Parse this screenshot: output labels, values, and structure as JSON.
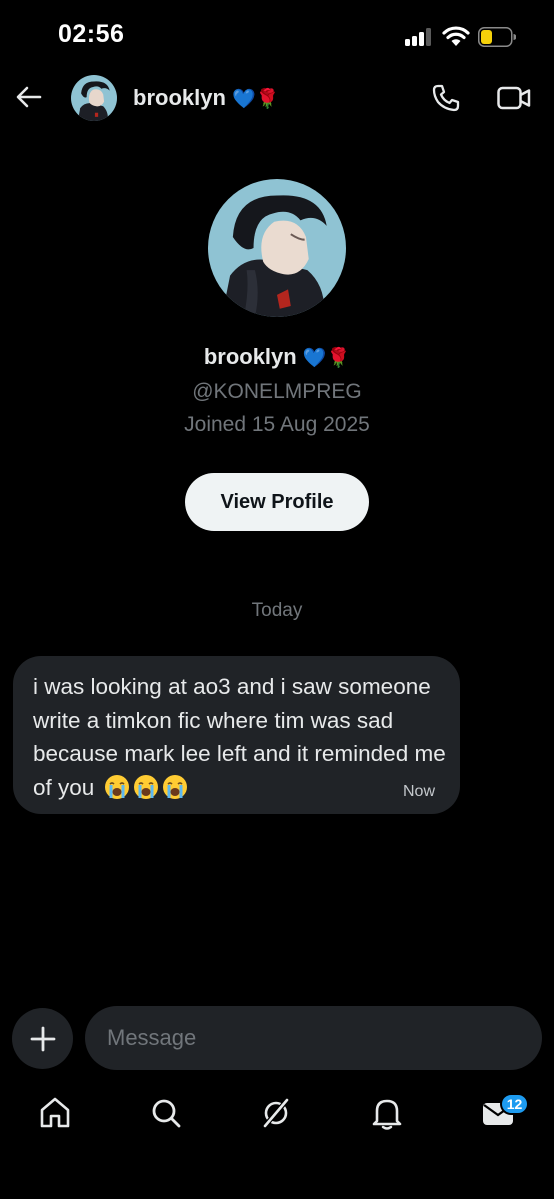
{
  "status_bar": {
    "time": "02:56"
  },
  "header": {
    "name": "brooklyn",
    "name_emojis": "💙🌹"
  },
  "profile": {
    "name": "brooklyn",
    "handle": "@KONELMPREG",
    "joined": "Joined 15 Aug 2025",
    "view_profile_label": "View Profile"
  },
  "conversation": {
    "date_label": "Today",
    "messages": [
      {
        "text": "i was looking at ao3 and i saw someone write a timkon fic where tim was sad because mark lee left and it reminded me of you",
        "emojis": "😭😭😭",
        "time": "Now"
      }
    ]
  },
  "composer": {
    "placeholder": "Message"
  },
  "tabbar": {
    "items": [
      "home-icon",
      "search-icon",
      "grok-icon",
      "notifications-icon",
      "messages-icon"
    ],
    "messages_badge": "12"
  },
  "colors": {
    "background": "#000000",
    "bubble": "#202327",
    "muted_text": "#71767b",
    "badge": "#1d9bf0",
    "battery_low": "#f5d10a"
  }
}
